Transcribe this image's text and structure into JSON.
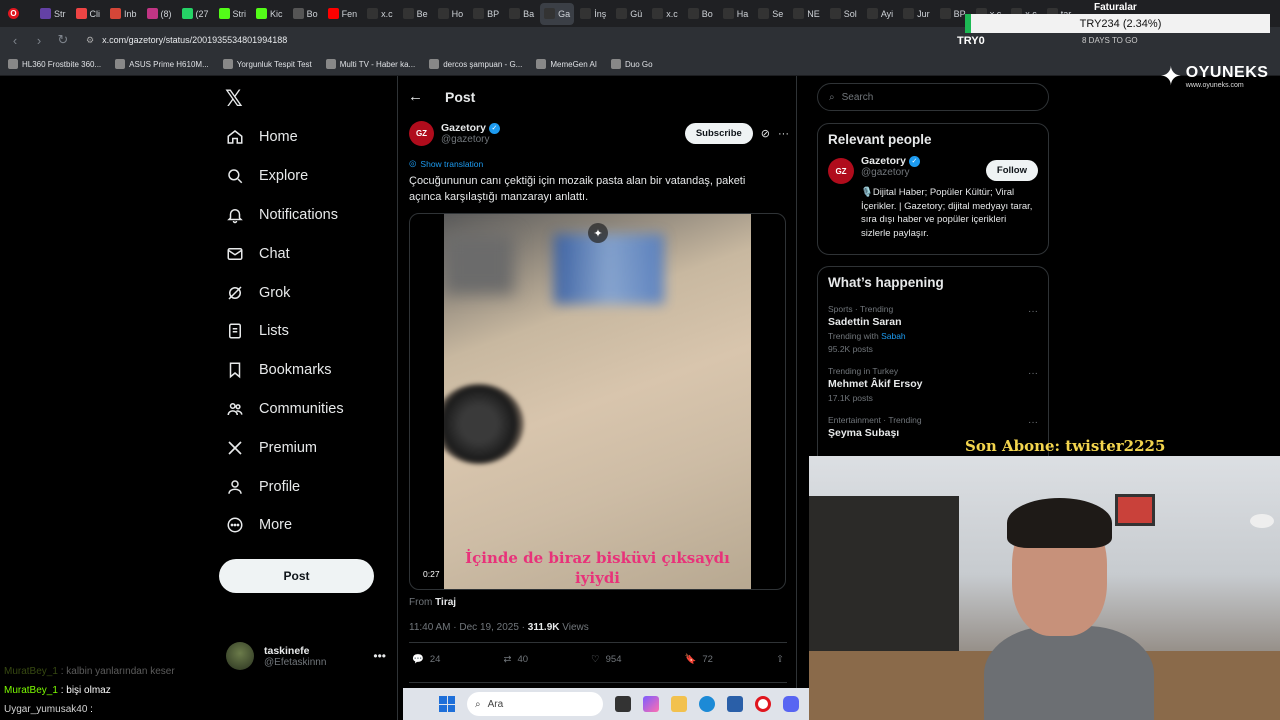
{
  "browser": {
    "tabs": [
      {
        "label": "Str",
        "color": "#6441a5",
        "active": false
      },
      {
        "label": "Cli",
        "color": "#e44",
        "active": false
      },
      {
        "label": "Inb",
        "color": "#d44638",
        "active": false
      },
      {
        "label": "(8)",
        "color": "#c13584",
        "active": false
      },
      {
        "label": "(27",
        "color": "#25d366",
        "active": false
      },
      {
        "label": "Stri",
        "color": "#53fc18",
        "active": false
      },
      {
        "label": "Kic",
        "color": "#53fc18",
        "active": false
      },
      {
        "label": "Bo",
        "color": "#555",
        "active": false
      },
      {
        "label": "Fen",
        "color": "#ff0000",
        "active": false
      },
      {
        "label": "x.c",
        "color": "#333",
        "active": false
      },
      {
        "label": "Be",
        "color": "#333",
        "active": false
      },
      {
        "label": "Ho",
        "color": "#333",
        "active": false
      },
      {
        "label": "BP",
        "color": "#333",
        "active": false
      },
      {
        "label": "Ba",
        "color": "#333",
        "active": false
      },
      {
        "label": "Ga",
        "color": "#333",
        "active": true
      },
      {
        "label": "İnş",
        "color": "#333",
        "active": false
      },
      {
        "label": "Gü",
        "color": "#333",
        "active": false
      },
      {
        "label": "x.c",
        "color": "#333",
        "active": false
      },
      {
        "label": "Bo",
        "color": "#333",
        "active": false
      },
      {
        "label": "Ha",
        "color": "#333",
        "active": false
      },
      {
        "label": "Se",
        "color": "#333",
        "active": false
      },
      {
        "label": "NE",
        "color": "#333",
        "active": false
      },
      {
        "label": "Sol",
        "color": "#333",
        "active": false
      },
      {
        "label": "Ayi",
        "color": "#333",
        "active": false
      },
      {
        "label": "Jur",
        "color": "#333",
        "active": false
      },
      {
        "label": "BP",
        "color": "#333",
        "active": false
      },
      {
        "label": "x.c",
        "color": "#333",
        "active": false
      },
      {
        "label": "x.c",
        "color": "#333",
        "active": false
      },
      {
        "label": "tar",
        "color": "#333",
        "active": false
      }
    ],
    "url": "x.com/gazetory/status/2001935534801994188",
    "bookmarks": [
      "HL360 Frostbite 360...",
      "ASUS Prime H610M...",
      "Yorgunluk Tespit Test",
      "Multi TV - Haber ka...",
      "dercos şampuan - G...",
      "MemeGen AI",
      "Duo Go"
    ]
  },
  "overlay": {
    "ticker_title": "Faturalar",
    "ticker_text": "TRY234 (2.34%)",
    "try_label": "TRY0",
    "days_label": "8 DAYS TO GO",
    "brand": "OYUNEKS",
    "brand_url": "www.oyuneks.com",
    "subscriber": "Son Abone: twister2225"
  },
  "nav": {
    "items": [
      {
        "label": "Home",
        "icon": "home-icon"
      },
      {
        "label": "Explore",
        "icon": "search-icon"
      },
      {
        "label": "Notifications",
        "icon": "bell-icon"
      },
      {
        "label": "Chat",
        "icon": "mail-icon"
      },
      {
        "label": "Grok",
        "icon": "grok-icon"
      },
      {
        "label": "Lists",
        "icon": "list-icon"
      },
      {
        "label": "Bookmarks",
        "icon": "bookmark-icon"
      },
      {
        "label": "Communities",
        "icon": "people-icon"
      },
      {
        "label": "Premium",
        "icon": "x-icon"
      },
      {
        "label": "Profile",
        "icon": "user-icon"
      },
      {
        "label": "More",
        "icon": "more-icon"
      }
    ],
    "post_label": "Post",
    "account": {
      "name": "taskinefe",
      "handle": "@Efetaskinnn"
    }
  },
  "post": {
    "header": "Post",
    "author": {
      "name": "Gazetory",
      "handle": "@gazetory",
      "avatar_text": "GZ"
    },
    "subscribe_label": "Subscribe",
    "show_translation": "Show translation",
    "text": "Çocuğununun canı çektiği için mozaik pasta alan bir vatandaş, paketi açınca karşılaştığı manzarayı anlattı.",
    "video_caption": "İçinde de biraz bisküvi çıksaydı iyiydi",
    "video_time": "0:27",
    "from_prefix": "From",
    "from_source": "Tiraj",
    "time": "11:40 AM · Dec 19, 2025 · ",
    "views": "311.9K",
    "views_label": " Views",
    "stats": {
      "replies": "24",
      "reposts": "40",
      "likes": "954",
      "bookmarks": "72"
    }
  },
  "sidebar": {
    "search_placeholder": "Search",
    "relevant_title": "Relevant people",
    "person": {
      "name": "Gazetory",
      "handle": "@gazetory",
      "bio": "🎙️Dijital Haber; Popüler Kültür; Viral İçerikler. | Gazetory; dijital medyayı tarar, sıra dışı haber ve popüler içerikleri sizlerle paylaşır.",
      "follow_label": "Follow"
    },
    "happening_title": "What’s happening",
    "trends": [
      {
        "context": "Sports · Trending",
        "topic": "Sadettin Saran",
        "sub_prefix": "Trending with ",
        "sub_link": "Sabah",
        "posts": "95.2K posts"
      },
      {
        "context": "Trending in Turkey",
        "topic": "Mehmet Âkif Ersoy",
        "sub_prefix": "",
        "sub_link": "",
        "posts": "17.1K posts"
      },
      {
        "context": "Entertainment · Trending",
        "topic": "Şeyma Subaşı",
        "sub_prefix": "",
        "sub_link": "",
        "posts": ""
      }
    ]
  },
  "chat": [
    {
      "user": "MuratBey_1",
      "msg": " : kalbin yanlarından keser",
      "faded": true
    },
    {
      "user": "MuratBey_1",
      "msg": " : bişi olmaz",
      "faded": false
    },
    {
      "user": "Uygar_yumusak40",
      "msg": " : ",
      "faded": false
    }
  ],
  "taskbar": {
    "search_placeholder": "Ara"
  }
}
